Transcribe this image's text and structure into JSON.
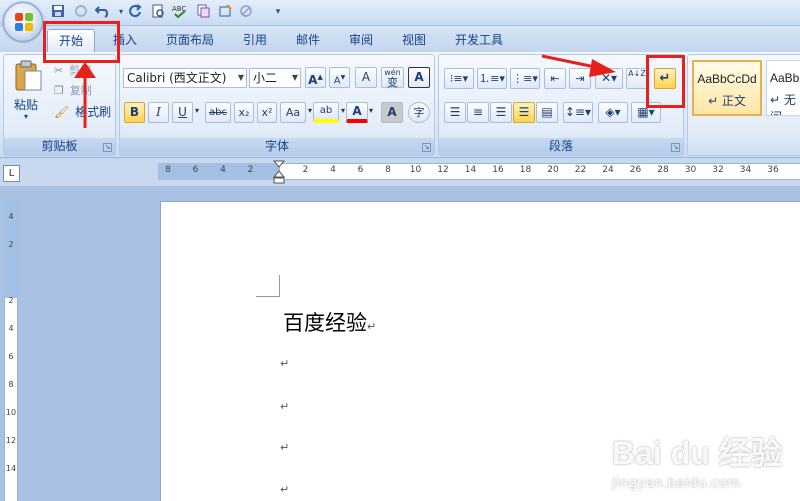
{
  "quick_access": {
    "icons": [
      "save-icon",
      "circle-icon",
      "undo-icon",
      "redo-icon",
      "print-preview-icon",
      "spelling-icon",
      "copy-icon",
      "insert-icon",
      "draw-icon"
    ],
    "customize_glyph": "▾"
  },
  "tabs": [
    {
      "label": "开始",
      "active": true
    },
    {
      "label": "插入",
      "active": false
    },
    {
      "label": "页面布局",
      "active": false
    },
    {
      "label": "引用",
      "active": false
    },
    {
      "label": "邮件",
      "active": false
    },
    {
      "label": "审阅",
      "active": false
    },
    {
      "label": "视图",
      "active": false
    },
    {
      "label": "开发工具",
      "active": false
    }
  ],
  "clipboard": {
    "group_label": "剪贴板",
    "paste_label": "粘贴",
    "cut_label": "剪切",
    "copy_label": "复制",
    "format_painter_label": "格式刷"
  },
  "font": {
    "group_label": "字体",
    "font_name": "Calibri (西文正文)",
    "font_size": "小二",
    "grow_label": "A",
    "shrink_label": "A",
    "clear_label": "A",
    "phonetic_label": "wén",
    "phonetic_char": "变",
    "border_label": "A",
    "bold": "B",
    "italic": "I",
    "underline": "U",
    "strikethrough": "abc",
    "subscript": "x₂",
    "superscript": "x²",
    "change_case": "Aa",
    "highlight": "ab",
    "font_color": "A",
    "shading": "A",
    "enclose": "字"
  },
  "paragraph": {
    "group_label": "段落",
    "sort_label": "A↓Z",
    "show_marks_label": "↵"
  },
  "styles": [
    {
      "sample": "AaBbCcDd",
      "name": "↵ 正文"
    },
    {
      "sample": "AaBb",
      "name": "↵ 无间"
    }
  ],
  "ruler": {
    "corner_label": "L",
    "ticks": [
      "8",
      "6",
      "4",
      "2",
      "",
      "2",
      "4",
      "6",
      "8",
      "10",
      "12",
      "14",
      "16",
      "18",
      "20",
      "22",
      "24",
      "26",
      "28",
      "30",
      "32",
      "34",
      "36"
    ],
    "vticks": [
      "4",
      "2",
      "",
      "2",
      "4",
      "6",
      "8",
      "10",
      "12",
      "14"
    ]
  },
  "document": {
    "title": "百度经验",
    "title_mark": "↵",
    "para_marks": [
      "↵",
      "↵",
      "↵",
      "↵"
    ]
  },
  "watermark": {
    "logo": "Bai du 经验",
    "url": "jingyan.baidu.com"
  },
  "colors": {
    "annotation": "#e8201b",
    "highlight_yellow": "#ffff00",
    "font_color_red": "#ff0000"
  }
}
